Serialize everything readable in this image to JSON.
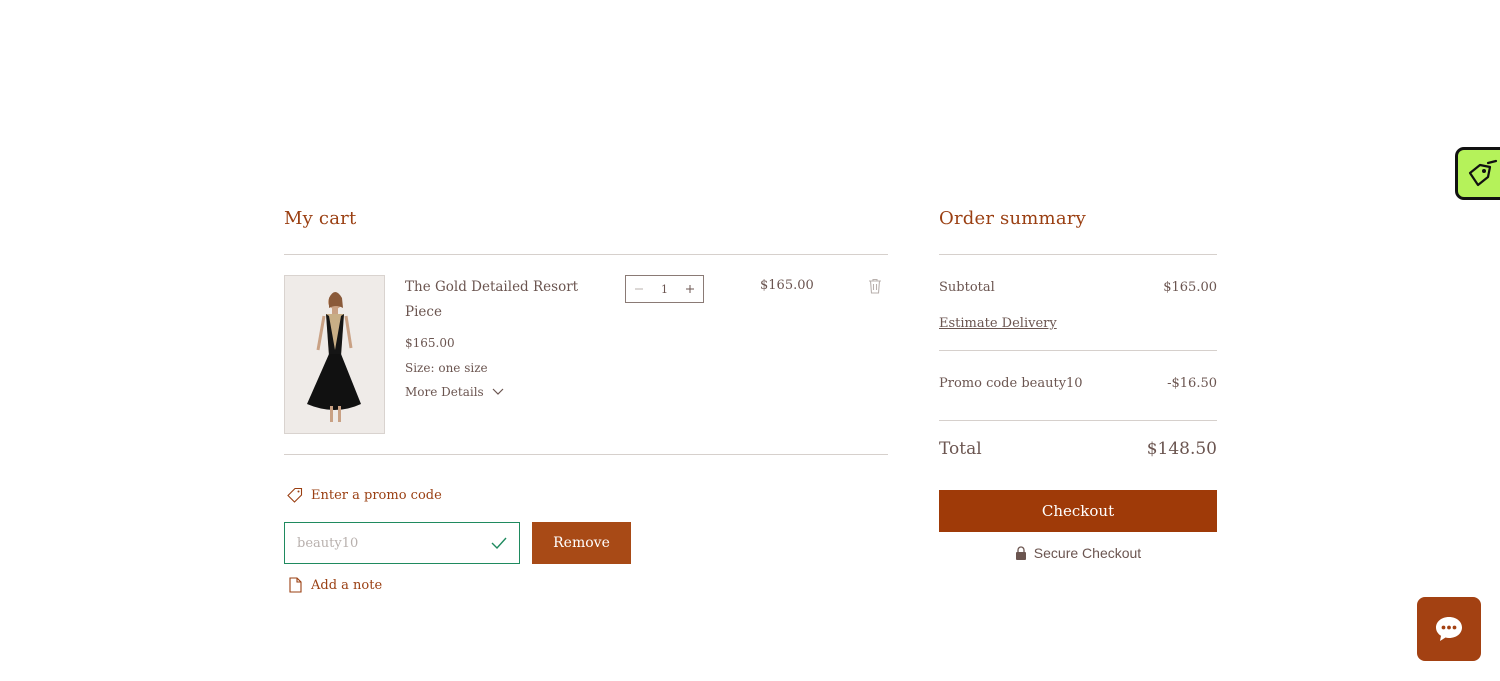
{
  "cart": {
    "title": "My cart",
    "item": {
      "name": "The Gold Detailed Resort Piece",
      "unit_price": "$165.00",
      "size": "Size: one size",
      "more_details": "More Details",
      "quantity": "1",
      "line_total": "$165.00"
    },
    "promo": {
      "link_label": "Enter a promo code",
      "input_value": "beauty10",
      "remove_label": "Remove"
    },
    "note_label": "Add a note"
  },
  "summary": {
    "title": "Order summary",
    "subtotal_label": "Subtotal",
    "subtotal_value": "$165.00",
    "estimate_label": "Estimate Delivery",
    "promo_label": "Promo code beauty10",
    "promo_value": "-$16.50",
    "total_label": "Total",
    "total_value": "$148.50",
    "checkout_label": "Checkout",
    "secure_label": "Secure Checkout"
  },
  "icons": {
    "tag": "tag-icon",
    "note": "document-icon",
    "check": "check-icon",
    "trash": "trash-icon",
    "lock": "lock-icon",
    "chat": "chat-bubble-icon",
    "widget": "tag-edit-icon"
  },
  "colors": {
    "accent": "#9f3a08",
    "promo_valid": "#1f8a5f",
    "widget_bg": "#b5f25a"
  }
}
